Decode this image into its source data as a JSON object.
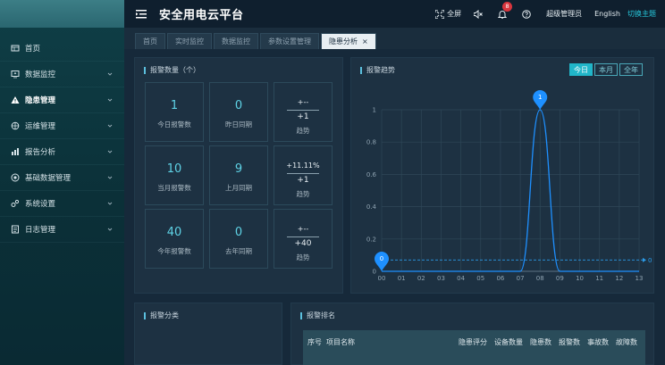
{
  "header": {
    "title": "安全用电云平台",
    "fullscreen_label": "全屏",
    "notification_count": "8",
    "user_label": "超级管理员",
    "language_label": "English",
    "switch_theme_label": "切换主题"
  },
  "sidebar": {
    "items": [
      {
        "label": "首页",
        "icon": "home-icon",
        "has_children": false
      },
      {
        "label": "数据监控",
        "icon": "monitor-icon",
        "has_children": true
      },
      {
        "label": "隐患管理",
        "icon": "warning-icon",
        "has_children": true,
        "active": true
      },
      {
        "label": "运维管理",
        "icon": "maintenance-icon",
        "has_children": true
      },
      {
        "label": "报告分析",
        "icon": "report-icon",
        "has_children": true
      },
      {
        "label": "基础数据管理",
        "icon": "database-icon",
        "has_children": true
      },
      {
        "label": "系统设置",
        "icon": "settings-icon",
        "has_children": true
      },
      {
        "label": "日志管理",
        "icon": "log-icon",
        "has_children": true
      }
    ]
  },
  "tabs": [
    {
      "label": "首页",
      "active": false
    },
    {
      "label": "实时监控",
      "active": false
    },
    {
      "label": "数据监控",
      "active": false
    },
    {
      "label": "参数设置管理",
      "active": false
    },
    {
      "label": "隐患分析",
      "active": true
    }
  ],
  "alarm_count": {
    "title": "报警数量（个）",
    "rows": [
      {
        "current": "1",
        "current_label": "今日报警数",
        "previous": "0",
        "previous_label": "昨日同期",
        "trend_pct": "+--",
        "trend_delta": "+1",
        "trend_label": "趋势"
      },
      {
        "current": "10",
        "current_label": "当月报警数",
        "previous": "9",
        "previous_label": "上月同期",
        "trend_pct": "+11.11%",
        "trend_delta": "+1",
        "trend_label": "趋势"
      },
      {
        "current": "40",
        "current_label": "今年报警数",
        "previous": "0",
        "previous_label": "去年同期",
        "trend_pct": "+--",
        "trend_delta": "+40",
        "trend_label": "趋势"
      }
    ]
  },
  "alarm_trend": {
    "title": "报警趋势",
    "range_tabs": [
      {
        "label": "今日",
        "active": true
      },
      {
        "label": "本月",
        "active": false
      },
      {
        "label": "全年",
        "active": false
      }
    ]
  },
  "chart_data": {
    "type": "line",
    "x": [
      "00",
      "01",
      "02",
      "03",
      "04",
      "05",
      "06",
      "07",
      "08",
      "09",
      "10",
      "11",
      "12",
      "13"
    ],
    "values": [
      0,
      0,
      0,
      0,
      0,
      0,
      0,
      0,
      1,
      0,
      0,
      0,
      0,
      0
    ],
    "ylim": [
      0,
      1
    ],
    "yticks": [
      "0",
      "0.2",
      "0.4",
      "0.6",
      "0.8",
      "1"
    ],
    "markers": [
      {
        "x": "08",
        "value": 1,
        "label": "1"
      },
      {
        "x": "00",
        "value": 0,
        "label": "0"
      }
    ],
    "average_line": {
      "value": 0.07,
      "label": "0"
    },
    "colors": {
      "line": "#1e90ff",
      "marker": "#1e90ff",
      "avg": "#2b9be8"
    },
    "grid": true
  },
  "alarm_category": {
    "title": "报警分类"
  },
  "alarm_ranking": {
    "title": "报警排名",
    "columns": [
      "序号",
      "项目名称",
      "隐患评分",
      "设备数量",
      "隐患数",
      "报警数",
      "事故数",
      "故障数"
    ]
  }
}
